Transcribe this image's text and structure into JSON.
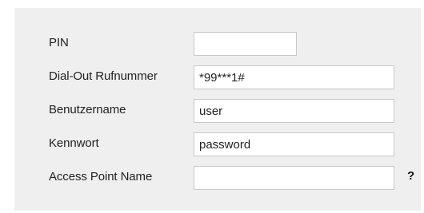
{
  "form": {
    "pin": {
      "label": "PIN",
      "value": ""
    },
    "dialout": {
      "label": "Dial-Out Rufnummer",
      "value": "*99***1#"
    },
    "username": {
      "label": "Benutzername",
      "value": "user"
    },
    "password": {
      "label": "Kennwort",
      "value": "password"
    },
    "apn": {
      "label": "Access Point Name",
      "value": "",
      "help": "?"
    }
  }
}
